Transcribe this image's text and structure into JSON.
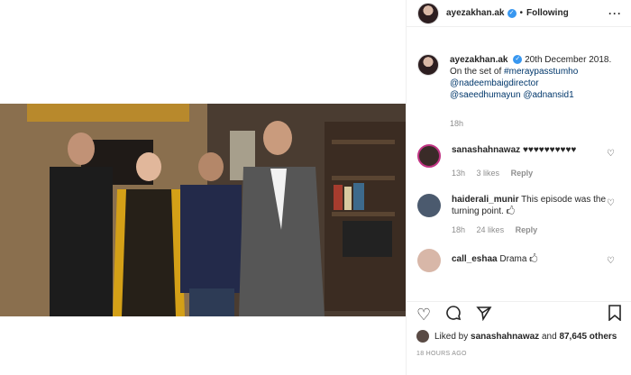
{
  "post": {
    "username": "ayezakhan.ak",
    "verified_glyph": "✓",
    "separator": "•",
    "follow_status": "Following",
    "more_glyph": "···"
  },
  "caption": {
    "username": "ayezakhan.ak",
    "line1": "20th December 2018.",
    "line2": "On the set of",
    "hashtag": "#meraypasstumho",
    "mention1": "@nadeembaigdirector",
    "mention2": "@saeedhumayun",
    "mention3": "@adnansid1",
    "time": "18h"
  },
  "comments": [
    {
      "username": "sanashahnawaz",
      "text": "♥♥♥♥♥♥♥♥♥♥",
      "time": "13h",
      "likes": "3 likes",
      "reply": "Reply"
    },
    {
      "username": "haiderali_munir",
      "text": "This episode was the turning point. 🖒",
      "time": "18h",
      "likes": "24 likes",
      "reply": "Reply"
    },
    {
      "username": "call_eshaa",
      "text": "Drama 🖒"
    }
  ],
  "likes": {
    "text": "Liked by",
    "user": "sanashahnawaz",
    "and": "and",
    "count": "87,645 others"
  },
  "timestamp": "18 HOURS AGO",
  "icons": {
    "like": "heart-icon",
    "comment": "comment-icon",
    "share": "share-icon",
    "save": "bookmark-icon"
  }
}
